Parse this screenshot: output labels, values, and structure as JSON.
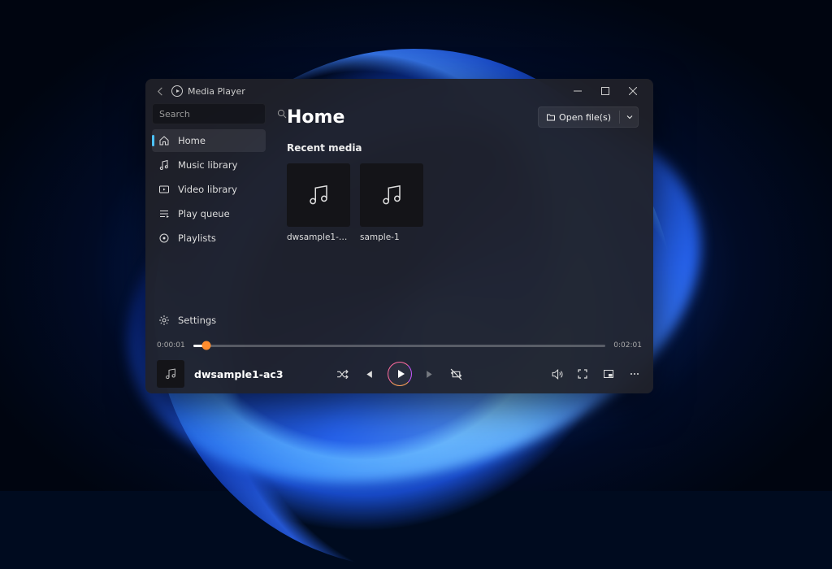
{
  "app": {
    "title": "Media Player"
  },
  "search": {
    "placeholder": "Search"
  },
  "nav": {
    "home": "Home",
    "music": "Music library",
    "video": "Video library",
    "queue": "Play queue",
    "playlists": "Playlists",
    "settings": "Settings"
  },
  "page": {
    "title": "Home",
    "openFiles": "Open file(s)",
    "recent": "Recent media"
  },
  "recent": [
    {
      "name": "dwsample1-ac3"
    },
    {
      "name": "sample-1"
    }
  ],
  "player": {
    "elapsed": "0:00:01",
    "total": "0:02:01",
    "nowPlaying": "dwsample1-ac3"
  }
}
